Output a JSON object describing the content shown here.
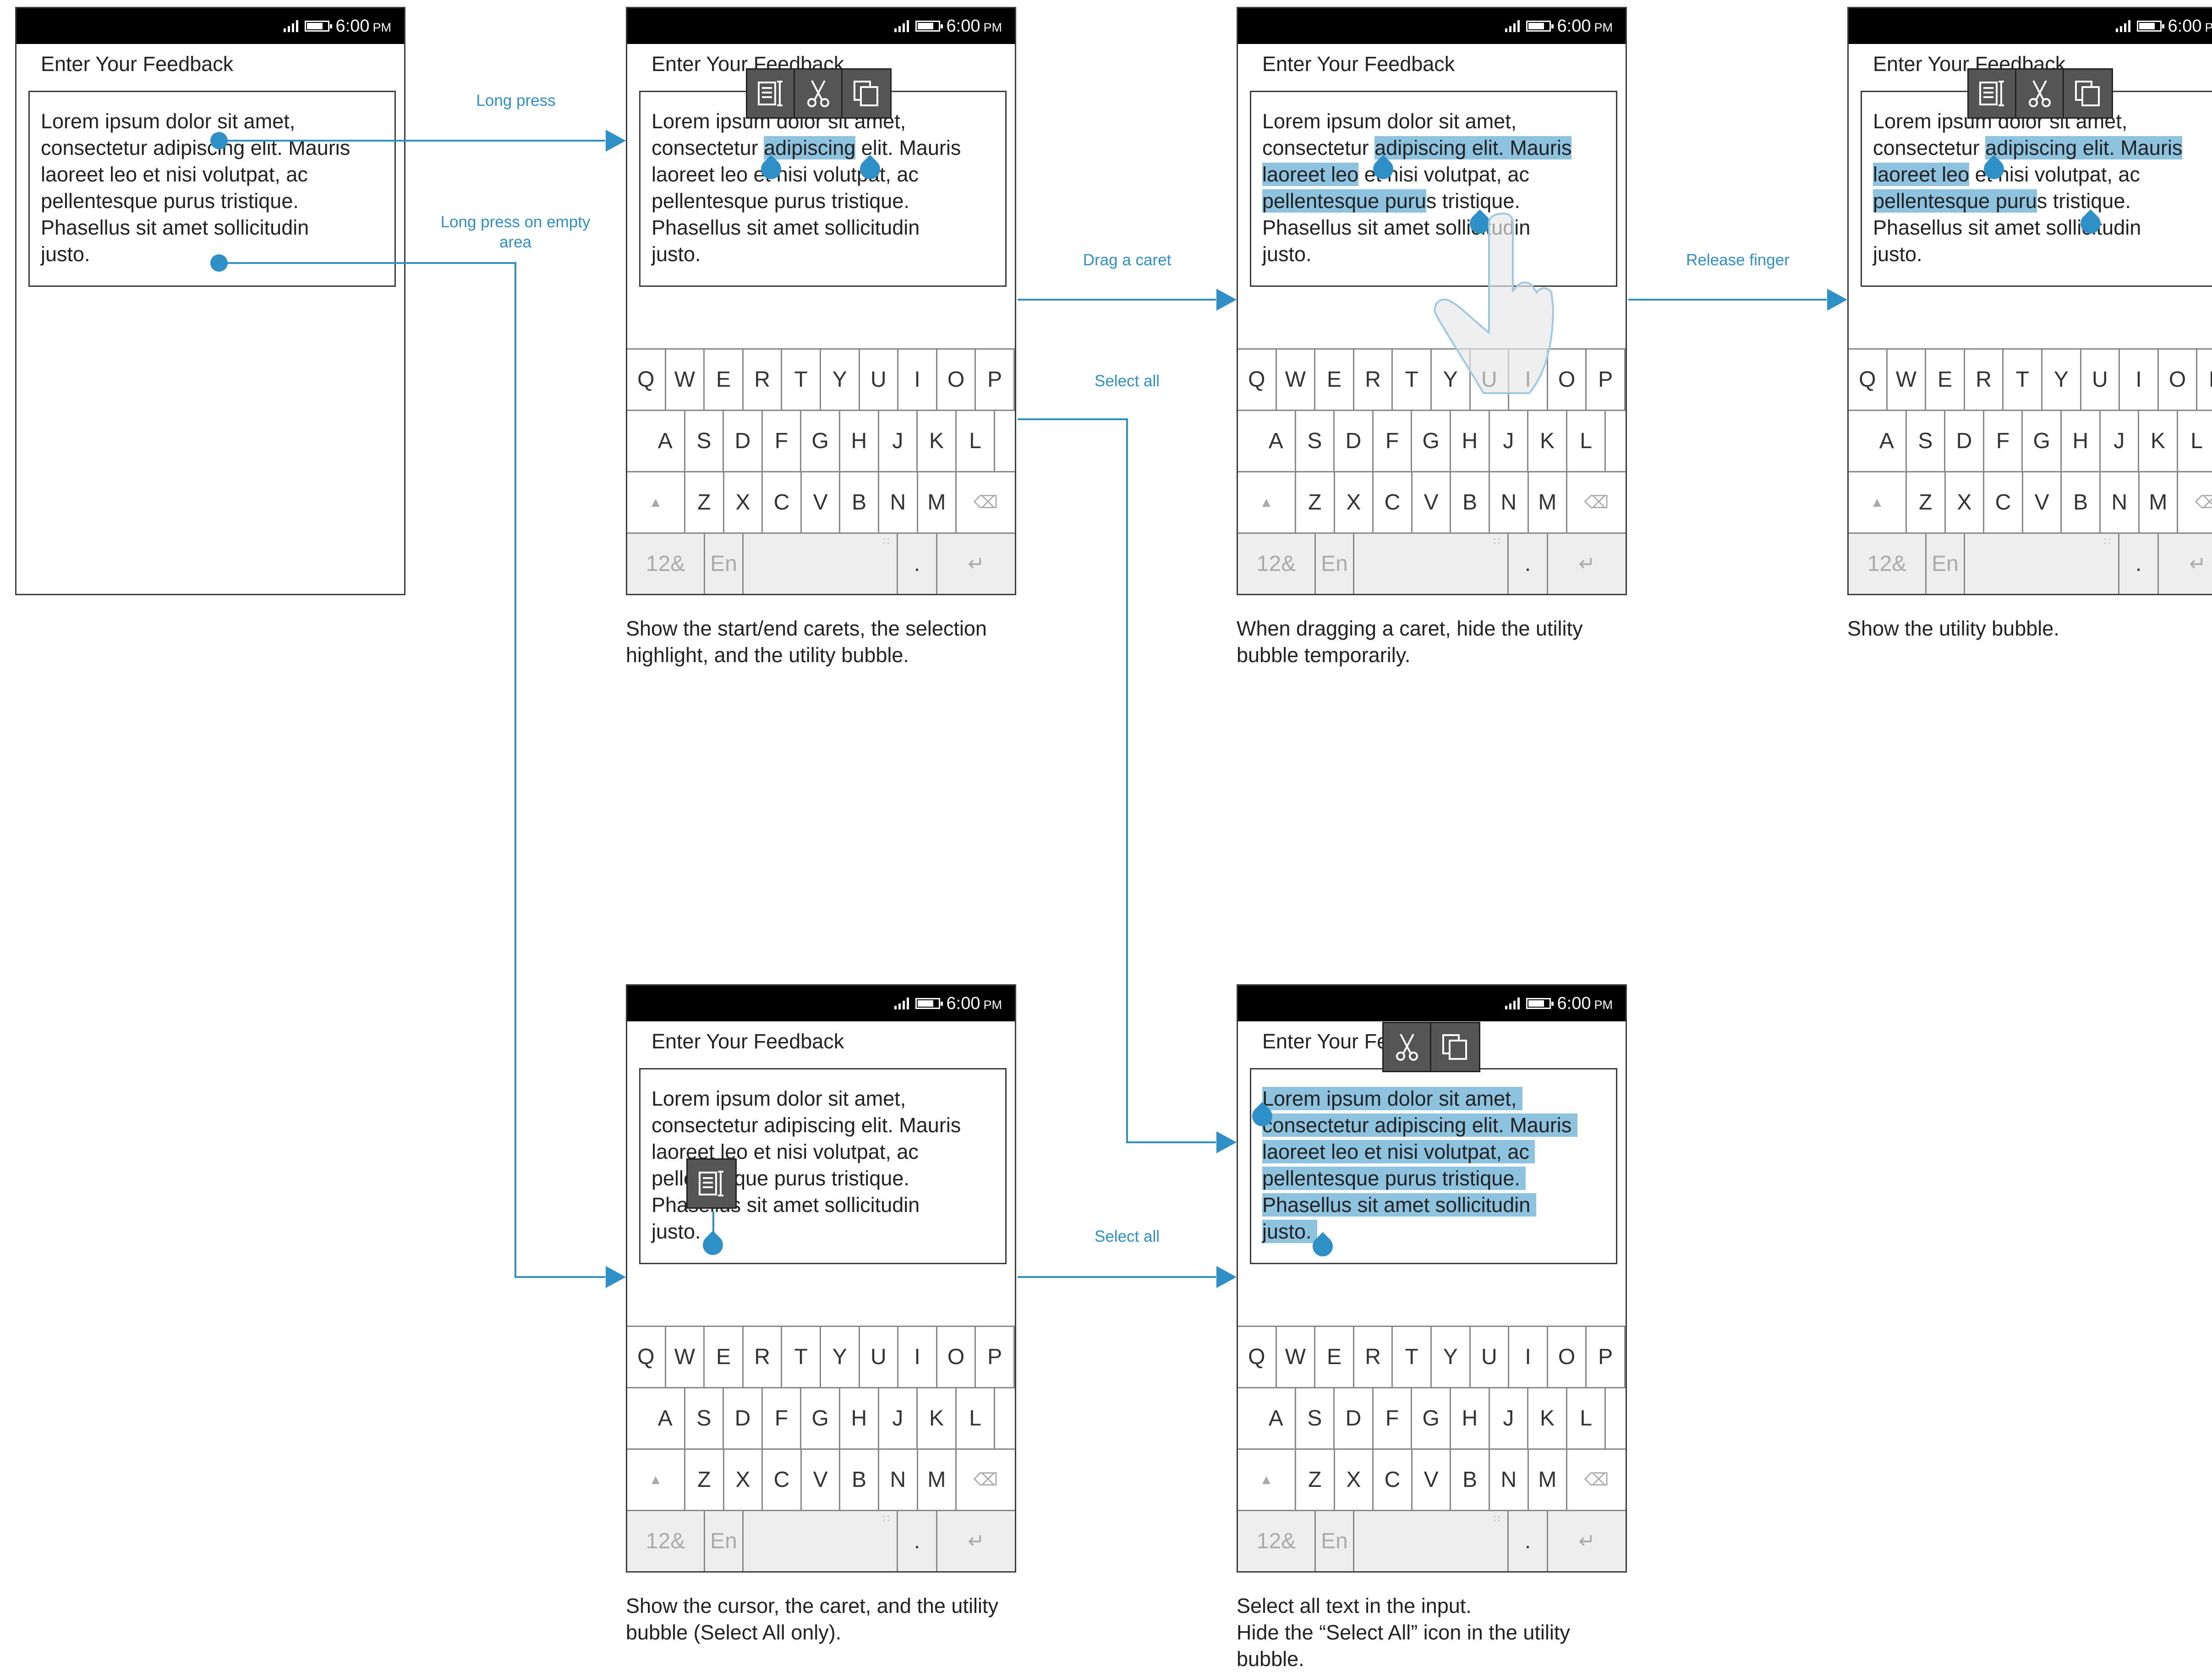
{
  "colors": {
    "accent": "#2f90c8",
    "highlight": "#8ec3e0",
    "statusbar": "#000000",
    "bubble": "#555555"
  },
  "status_bar": {
    "time": "6:00",
    "ampm": "PM"
  },
  "app": {
    "header_title": "Enter Your Feedback"
  },
  "text_lines": [
    "Lorem ipsum dolor sit amet,",
    "consectetur adipiscing elit. Mauris",
    "laoreet leo et nisi volutpat, ac",
    "pellentesque purus tristique.",
    "Phasellus sit amet sollicitudin",
    "justo."
  ],
  "keyboard": {
    "row1": [
      "Q",
      "W",
      "E",
      "R",
      "T",
      "Y",
      "U",
      "I",
      "O",
      "P"
    ],
    "row2": [
      "A",
      "S",
      "D",
      "F",
      "G",
      "H",
      "J",
      "K",
      "L"
    ],
    "row3": [
      "Z",
      "X",
      "C",
      "V",
      "B",
      "N",
      "M"
    ],
    "numeric_label": "12&",
    "lang_label": "En",
    "period_label": "."
  },
  "bubble_icons": {
    "full": [
      "select-all-icon",
      "cut-icon",
      "copy-icon"
    ],
    "select_all_only": [
      "select-all-icon"
    ],
    "without_select_all": [
      "cut-icon",
      "copy-icon"
    ]
  },
  "flow_labels": {
    "long_press": "Long press",
    "long_press_empty": "Long press on empty area",
    "drag_a_caret": "Drag a caret",
    "select_all_top": "Select all",
    "release_finger": "Release finger",
    "select_all_bottom": "Select all"
  },
  "captions": {
    "phase2": "Show the start/end carets, the selection highlight, and the utility bubble.",
    "phase3": "When dragging a caret, hide the utility bubble temporarily.",
    "phase4": "Show the utility bubble.",
    "cursor": "Show the cursor, the caret, and the utility bubble (Select All only).",
    "select_all": [
      "Select all text in the input.",
      "Hide the “Select All” icon in the utility bubble."
    ]
  }
}
